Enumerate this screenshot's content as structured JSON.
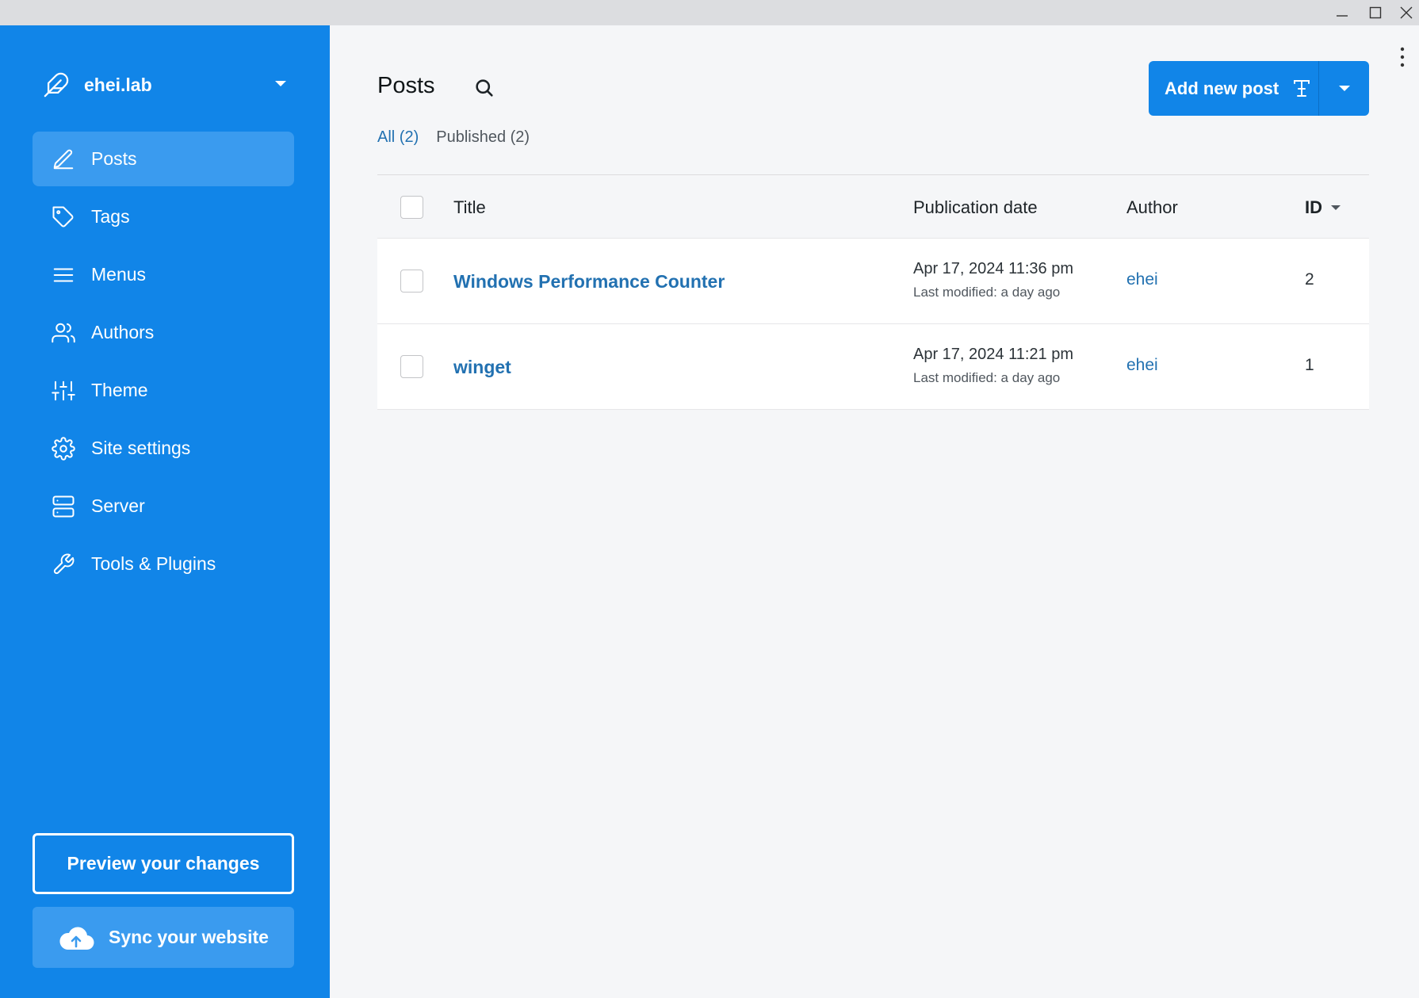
{
  "sidebar": {
    "site_name": "ehei.lab",
    "items": [
      {
        "label": "Posts",
        "icon": "pencil-icon",
        "active": true
      },
      {
        "label": "Tags",
        "icon": "tag-icon"
      },
      {
        "label": "Menus",
        "icon": "menu-icon"
      },
      {
        "label": "Authors",
        "icon": "users-icon"
      },
      {
        "label": "Theme",
        "icon": "sliders-icon"
      },
      {
        "label": "Site settings",
        "icon": "gear-icon"
      },
      {
        "label": "Server",
        "icon": "server-icon"
      },
      {
        "label": "Tools & Plugins",
        "icon": "wrench-icon"
      }
    ],
    "preview_label": "Preview your changes",
    "sync_label": "Sync your website"
  },
  "main": {
    "title": "Posts",
    "add_button_label": "Add new post",
    "filters": [
      {
        "label": "All (2)",
        "active": true
      },
      {
        "label": "Published (2)",
        "active": false
      }
    ],
    "table": {
      "headers": {
        "title": "Title",
        "publication_date": "Publication date",
        "author": "Author",
        "id": "ID"
      },
      "rows": [
        {
          "title": "Windows Performance Counter",
          "date": "Apr 17, 2024 11:36 pm",
          "modified": "Last modified: a day ago",
          "author": "ehei",
          "id": "2"
        },
        {
          "title": "winget",
          "date": "Apr 17, 2024 11:21 pm",
          "modified": "Last modified: a day ago",
          "author": "ehei",
          "id": "1"
        }
      ]
    }
  },
  "colors": {
    "sidebar_bg": "#1185e8",
    "sidebar_active": "#3a9bef",
    "link": "#2271b1",
    "page_bg": "#f5f6f8"
  }
}
